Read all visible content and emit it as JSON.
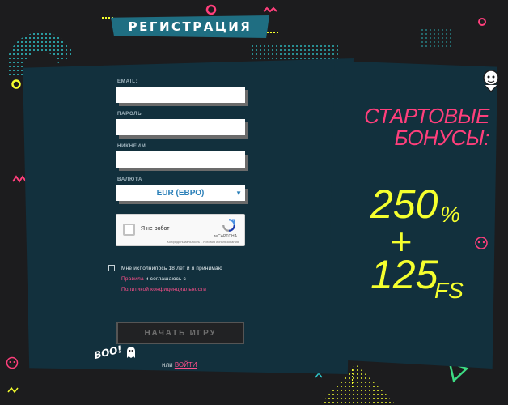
{
  "header": {
    "title": "РЕГИСТРАЦИЯ"
  },
  "form": {
    "email_label": "EMAIL:",
    "email_value": "",
    "password_label": "ПАРОЛЬ",
    "password_value": "",
    "nickname_label": "НИКНЕЙМ",
    "nickname_value": "",
    "currency_label": "ВАЛЮТА",
    "currency_value": "EUR (ЕВРО)",
    "captcha": {
      "label": "Я не робот",
      "brand": "reCAPTCHA",
      "legal": "Конфиденциальность - Условия использования"
    },
    "agree_text_1": "Мне исполнилось 18 лет и я принимаю",
    "agree_link_rules": "Правила",
    "agree_text_2": " и соглашаюсь с",
    "agree_link_privacy": "Политикой конфиденциальности",
    "submit_label": "НАЧАТЬ ИГРУ",
    "or_label": "или ",
    "login_label": "ВОЙТИ"
  },
  "promo": {
    "title_line1": "СТАРТОВЫЕ",
    "title_line2": "БОНУСЫ:",
    "amount_1": "250",
    "amount_1_unit": "%",
    "plus": "+",
    "amount_2": "125",
    "amount_2_unit": "FS"
  },
  "mascot": {
    "boo_text": "BOO!"
  },
  "colors": {
    "background": "#1c1c1e",
    "panel": "#12303d",
    "banner": "#1f6e82",
    "accent_pink": "#ff3f7c",
    "accent_yellow": "#f5ff2e",
    "accent_green": "#3ddc84",
    "link": "#ff4f8b"
  }
}
